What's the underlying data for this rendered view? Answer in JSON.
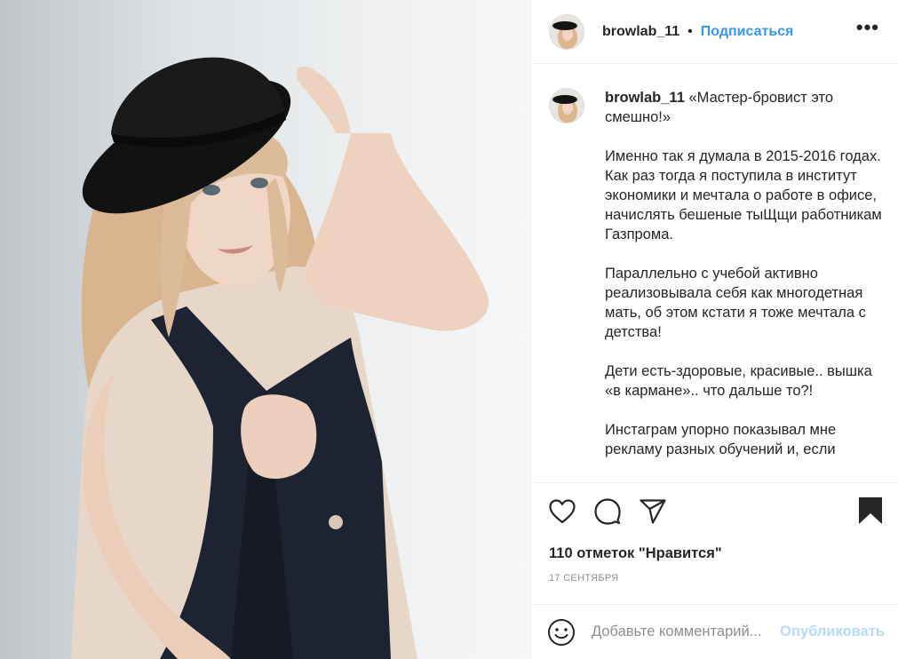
{
  "post": {
    "username": "browlab_11",
    "separator": "•",
    "follow_label": "Подписаться",
    "more_label": "•••",
    "caption": {
      "username": "browlab_11",
      "text": " «Мастер-бровист это смешно!»\n\nИменно так я думала в 2015-2016 годах.\nКак раз тогда я поступила в институт экономики и мечтала о работе в офисе, начислять бешеные тыЩщи работникам Газпрома.\n\nПараллельно с учебой активно реализовывала себя как многодетная мать, об этом кстати я тоже мечтала с детства!\n\nДети есть-здоровые, красивые.. вышка «в кармане».. что дальше то?!\n\nИнстаграм упорно показывал мне рекламу разных обучений и, если"
    },
    "likes": "110 отметок \"Нравится\"",
    "date": "17 сентября"
  },
  "icons": {
    "like": "heart-icon",
    "comment": "comment-icon",
    "share": "paper-plane-icon",
    "save": "bookmark-icon",
    "emoji": "smiley-icon",
    "more": "ellipsis-icon"
  },
  "comment": {
    "placeholder": "Добавьте комментарий...",
    "post_label": "Опубликовать"
  },
  "colors": {
    "accent": "#3897f0",
    "accent_disabled": "#b3dbff",
    "text": "#262626",
    "muted": "#8e8e8e",
    "divider": "#efefef"
  }
}
